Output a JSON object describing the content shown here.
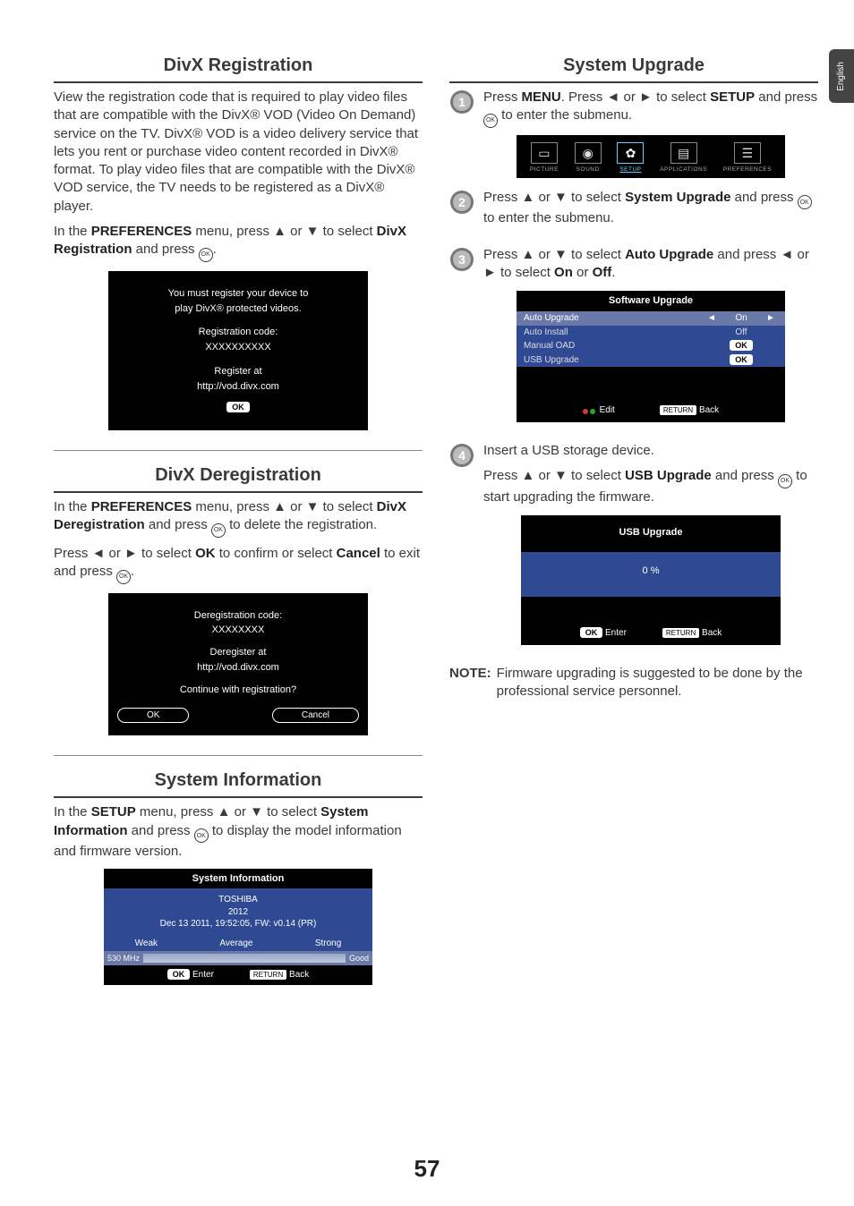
{
  "sideTab": "English",
  "pageNumber": "57",
  "left": {
    "divxReg": {
      "title": "DivX Registration",
      "intro": "View the registration code that is required to play video files that are compatible with the DivX® VOD (Video On Demand) service on the TV. DivX® VOD is a video delivery service that lets you rent or purchase video content recorded in DivX® format. To play video files that are compatible with the DivX® VOD service, the TV needs to be registered as a DivX® player.",
      "instr_a": "In the ",
      "instr_b": "PREFERENCES",
      "instr_c": " menu, press ▲ or ▼ to select ",
      "instr_d": "DivX Registration",
      "instr_e": " and press ",
      "osd": {
        "l1": "You must register your device to",
        "l2": "play DivX® protected videos.",
        "l3": "Registration code:",
        "l4": "XXXXXXXXXX",
        "l5": "Register at",
        "l6": "http://vod.divx.com",
        "ok": "OK"
      }
    },
    "divxDereg": {
      "title": "DivX Deregistration",
      "p1_a": "In the ",
      "p1_b": "PREFERENCES",
      "p1_c": " menu, press ▲ or ▼ to select ",
      "p1_d": "DivX Deregistration",
      "p1_e": " and press ",
      "p1_f": " to delete the registration.",
      "p2_a": "Press ◄ or ► to select ",
      "p2_b": "OK",
      "p2_c": " to confirm or select ",
      "p2_d": "Cancel",
      "p2_e": " to exit and press ",
      "osd": {
        "l1": "Deregistration code:",
        "l2": "XXXXXXXX",
        "l3": "Deregister at",
        "l4": "http://vod.divx.com",
        "l5": "Continue with registration?",
        "ok": "OK",
        "cancel": "Cancel"
      }
    },
    "sysInfo": {
      "title": "System Information",
      "p_a": "In the ",
      "p_b": "SETUP",
      "p_c": " menu, press ▲ or ▼ to select ",
      "p_d": "System Information",
      "p_e": " and press ",
      "p_f": " to display the model information and firmware version.",
      "osd": {
        "title": "System Information",
        "brand": "TOSHIBA",
        "year": "2012",
        "fw": "Dec 13 2011, 19:52:05, FW: v0.14 (PR)",
        "weak": "Weak",
        "avg": "Average",
        "strong": "Strong",
        "freq": "530 MHz",
        "good": "Good",
        "ok": "OK",
        "enter": "Enter",
        "ret": "RETURN",
        "back": "Back"
      }
    }
  },
  "right": {
    "title": "System Upgrade",
    "s1_a": "Press ",
    "s1_b": "MENU",
    "s1_c": ". Press ◄ or ► to select ",
    "s1_d": "SETUP",
    "s1_e": " and press ",
    "s1_f": " to enter  the submenu.",
    "bar": {
      "picture": "PICTURE",
      "sound": "SOUND",
      "setup": "SETUP",
      "apps": "APPLICATIONS",
      "prefs": "PREFERENCES"
    },
    "s2_a": "Press ▲ or ▼ to select ",
    "s2_b": "System Upgrade",
    "s2_c": " and press ",
    "s2_d": " to enter the submenu.",
    "s3_a": "Press ▲ or ▼ to select ",
    "s3_b": "Auto Upgrade",
    "s3_c": " and press ◄ or ► to select ",
    "s3_d": "On",
    "s3_e": " or ",
    "s3_f": "Off",
    "swup": {
      "title": "Software Upgrade",
      "r1": "Auto Upgrade",
      "r1v": "On",
      "r2": "Auto Install",
      "r2v": "Off",
      "r3": "Manual OAD",
      "r3v": "OK",
      "r4": "USB Upgrade",
      "r4v": "OK",
      "edit": "Edit",
      "ret": "RETURN",
      "back": "Back"
    },
    "s4_a": "Insert a USB storage device.",
    "s4_b": "Press ▲ or ▼ to select ",
    "s4_c": "USB Upgrade",
    "s4_d": " and press ",
    "s4_e": " to start upgrading the firmware.",
    "usb": {
      "title": "USB Upgrade",
      "pct": "0 %",
      "ok": "OK",
      "enter": "Enter",
      "ret": "RETURN",
      "back": "Back"
    },
    "note_l": "NOTE:",
    "note_t": "Firmware upgrading is suggested to be done by the professional service personnel."
  }
}
